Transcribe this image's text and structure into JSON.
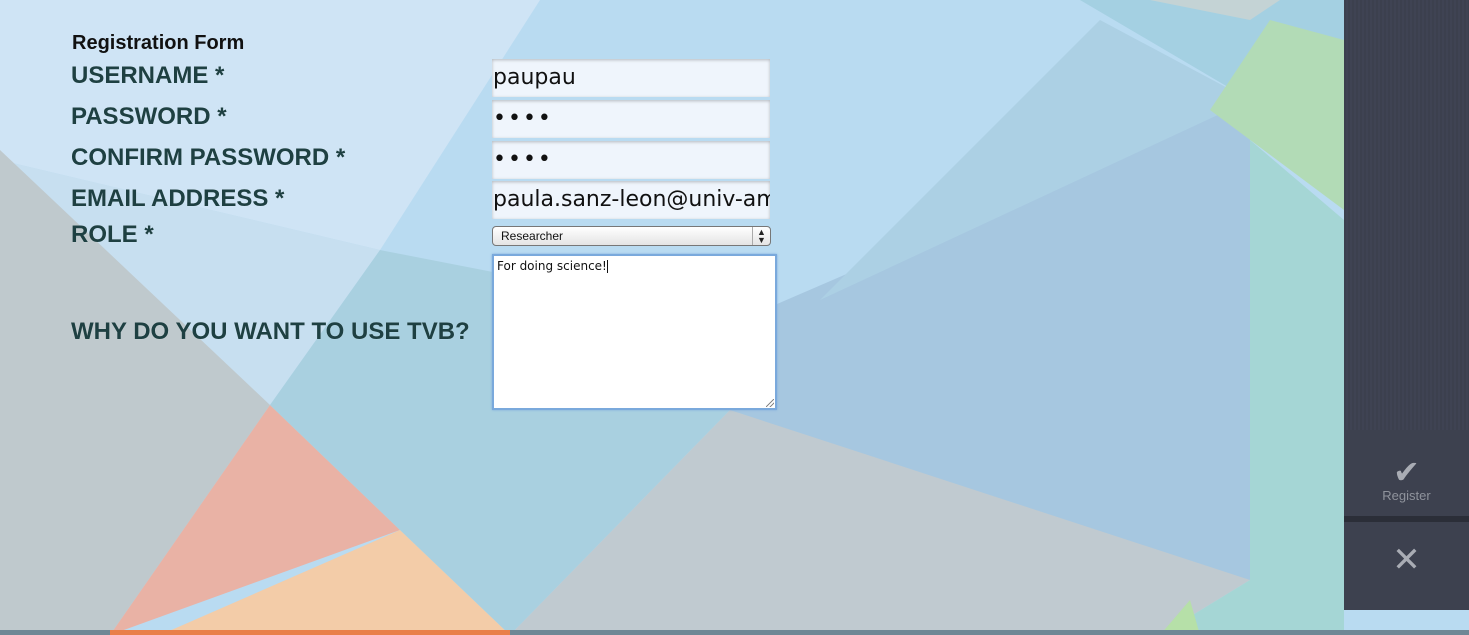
{
  "form": {
    "title": "Registration Form",
    "labels": {
      "username": "USERNAME *",
      "password": "PASSWORD *",
      "confirm_password": "CONFIRM PASSWORD *",
      "email": "EMAIL ADDRESS *",
      "role": "ROLE *",
      "why": "WHY DO YOU WANT TO USE TVB?"
    },
    "values": {
      "username": "paupau",
      "password": "••••",
      "confirm_password": "••••",
      "email": "paula.sanz-leon@univ-am",
      "role": "Researcher",
      "why": "For doing science!"
    }
  },
  "sidebar": {
    "register_label": "Register",
    "register_icon": "checkmark-icon",
    "close_icon": "close-icon"
  },
  "colors": {
    "label_text": "#1e4042",
    "sidebar_bg": "#3d414f",
    "textarea_focus": "#7aa9dc"
  }
}
